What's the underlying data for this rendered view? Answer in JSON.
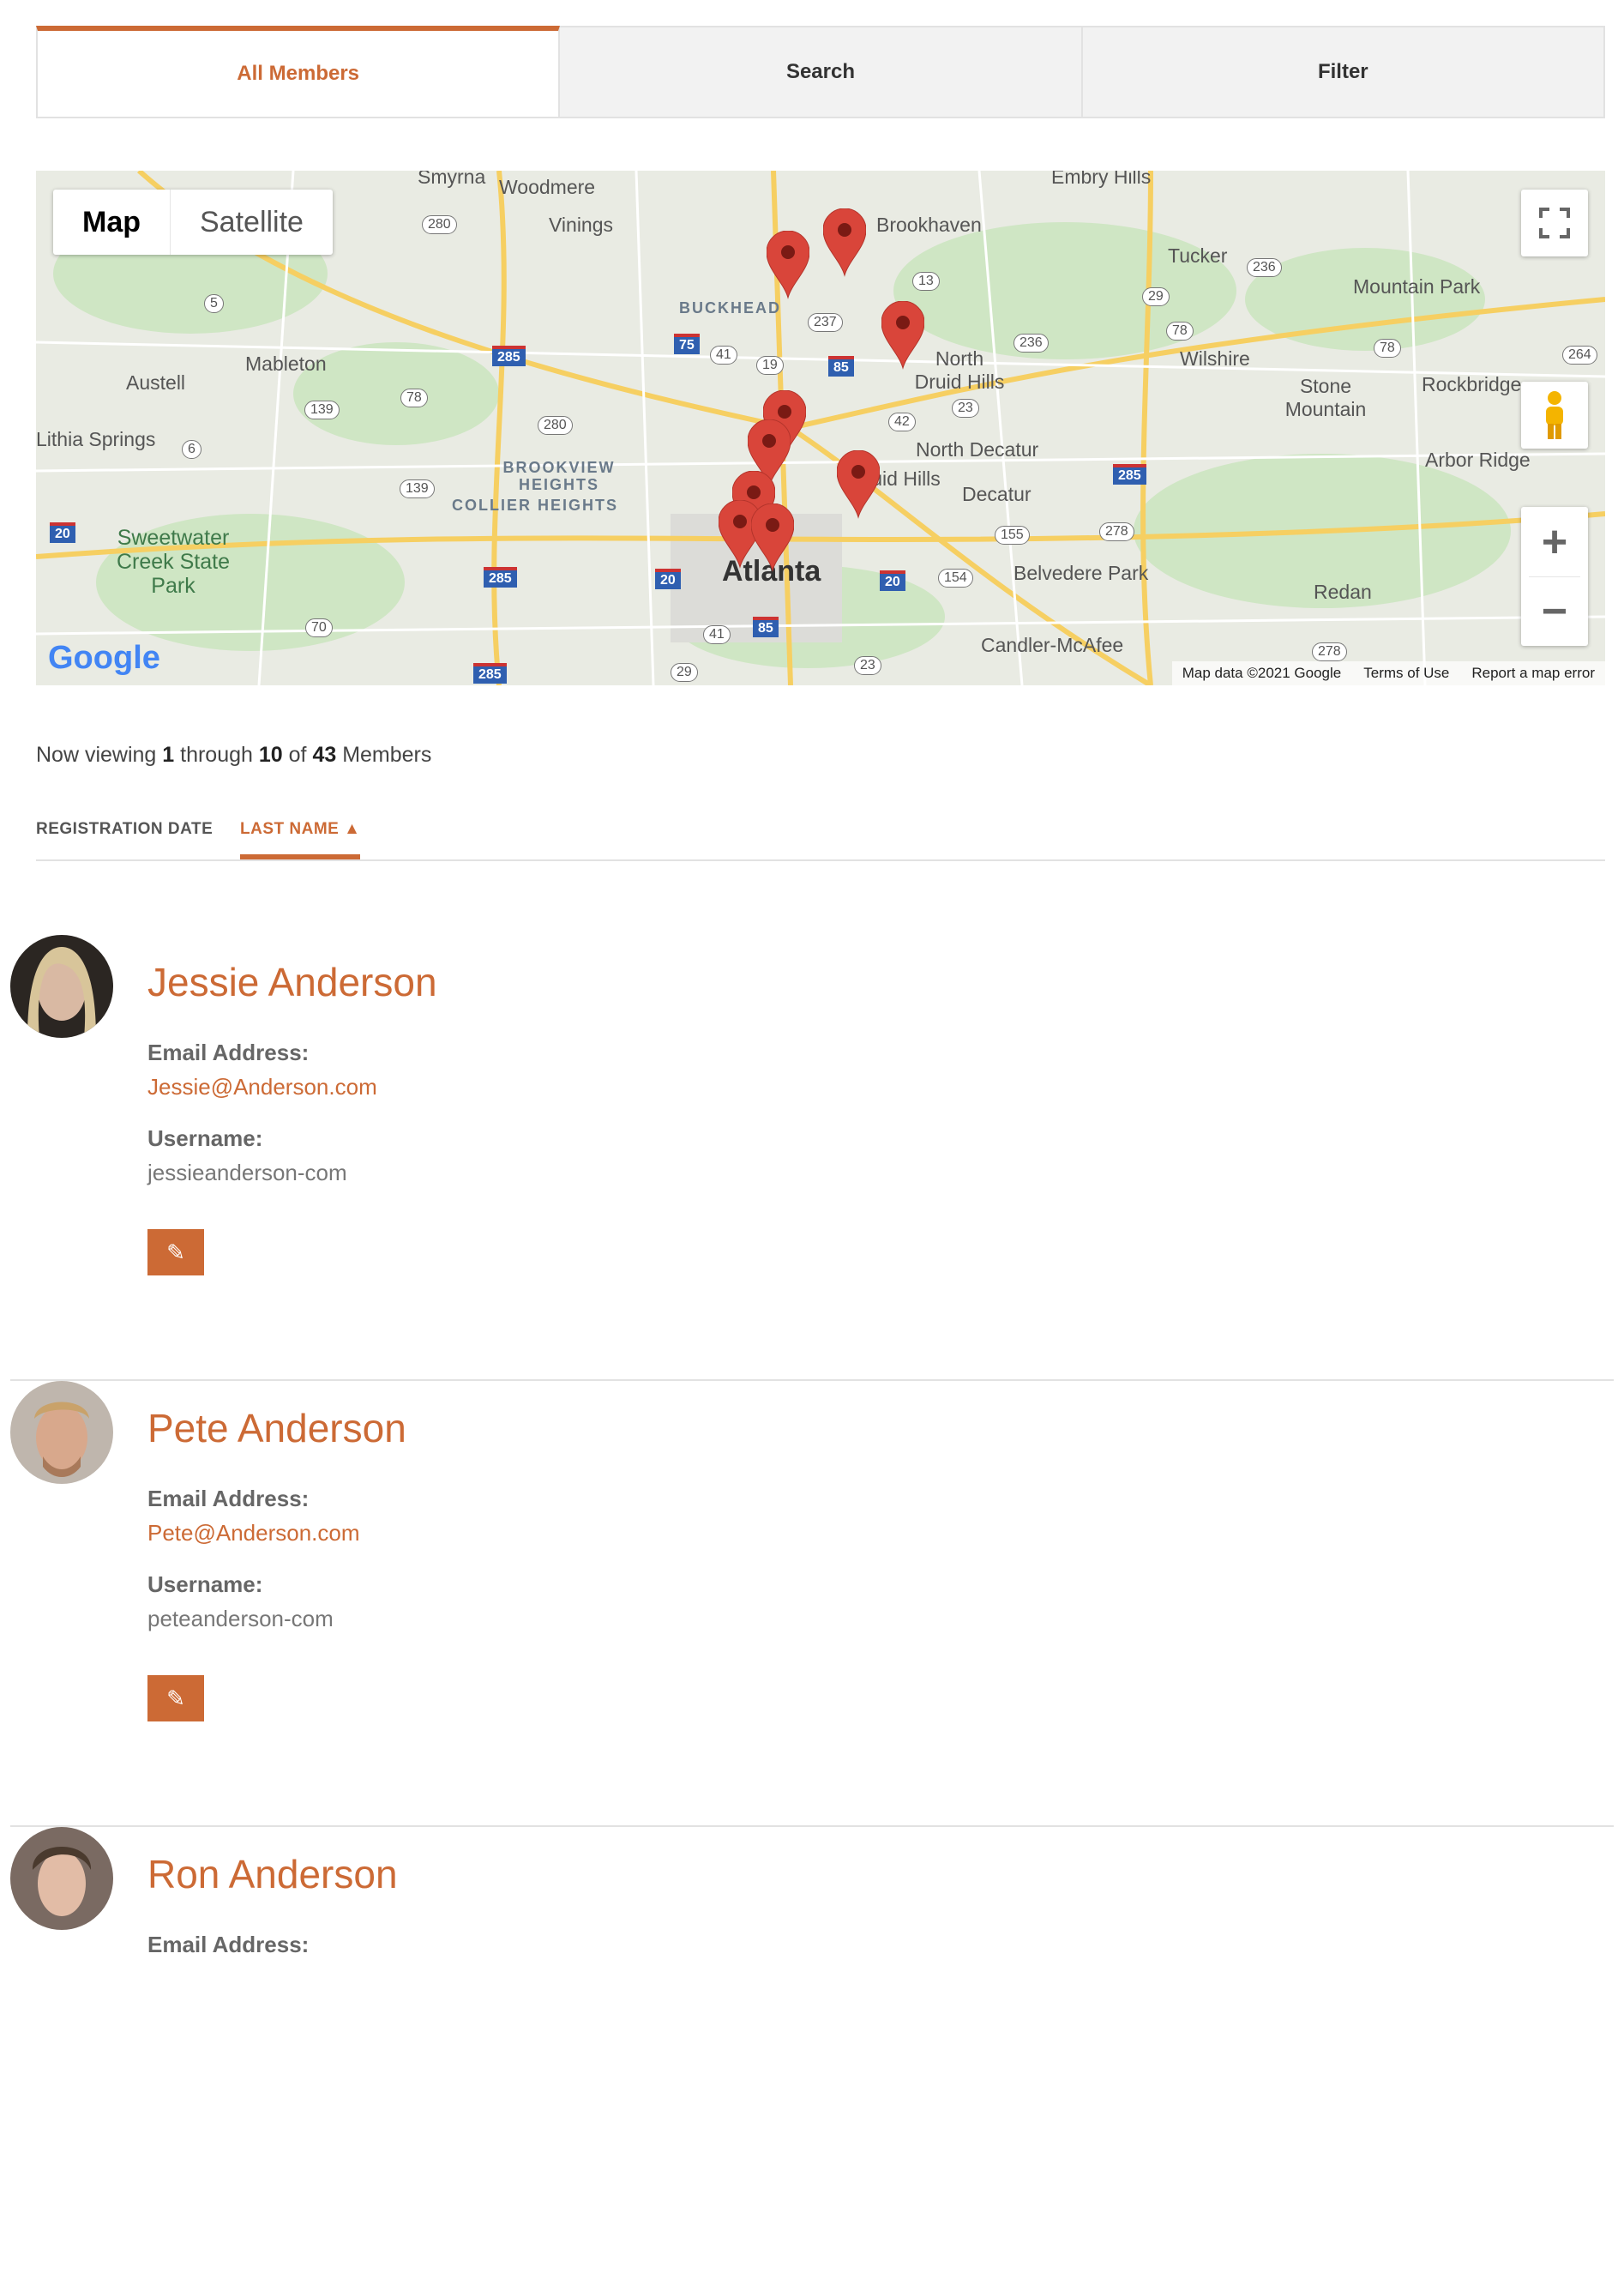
{
  "tabs": [
    {
      "label": "All Members",
      "active": true
    },
    {
      "label": "Search",
      "active": false
    },
    {
      "label": "Filter",
      "active": false
    }
  ],
  "map": {
    "type_buttons": {
      "map": "Map",
      "satellite": "Satellite"
    },
    "labels": {
      "smyrna": "Smyrna",
      "woodmere": "Woodmere",
      "vinings": "Vinings",
      "embry_hills": "Embry Hills",
      "brookhaven": "Brookhaven",
      "tucker": "Tucker",
      "mountain_park": "Mountain Park",
      "buckhead": "BUCKHEAD",
      "mableton": "Mableton",
      "austell": "Austell",
      "north_druid_hills": "North Druid Hills",
      "wilshire": "Wilshire",
      "stone_mountain": "Stone Mountain",
      "rockbridge": "Rockbridge",
      "lithia_springs": "Lithia Springs",
      "north_decatur": "North Decatur",
      "arbor_ridge": "Arbor Ridge",
      "brookview_heights": "BROOKVIEW HEIGHTS",
      "collier_heights": "COLLIER HEIGHTS",
      "druid_hills": "Druid Hills",
      "decatur": "Decatur",
      "sweetwater": "Sweetwater Creek State Park",
      "atlanta": "Atlanta",
      "belvedere_park": "Belvedere Park",
      "redan": "Redan",
      "candler_mcafee": "Candler-McAfee"
    },
    "google_logo": "Google",
    "footer": {
      "data": "Map data ©2021 Google",
      "terms": "Terms of Use",
      "report": "Report a map error"
    }
  },
  "viewing": {
    "prefix": "Now viewing ",
    "start": "1",
    "mid": " through ",
    "end": "10",
    "of": " of ",
    "total": "43",
    "suffix": " Members"
  },
  "sort": {
    "registration": "REGISTRATION DATE",
    "last_name": "LAST NAME ▲"
  },
  "members": [
    {
      "name": "Jessie Anderson",
      "email_label": "Email Address:",
      "email": "Jessie@Anderson.com",
      "username_label": "Username:",
      "username": "jessieanderson-com",
      "edit_icon": "✎"
    },
    {
      "name": "Pete Anderson",
      "email_label": "Email Address:",
      "email": "Pete@Anderson.com",
      "username_label": "Username:",
      "username": "peteanderson-com",
      "edit_icon": "✎"
    },
    {
      "name": "Ron Anderson",
      "email_label": "Email Address:"
    }
  ],
  "colors": {
    "accent": "#cc6a35",
    "pin": "#d9453a"
  }
}
